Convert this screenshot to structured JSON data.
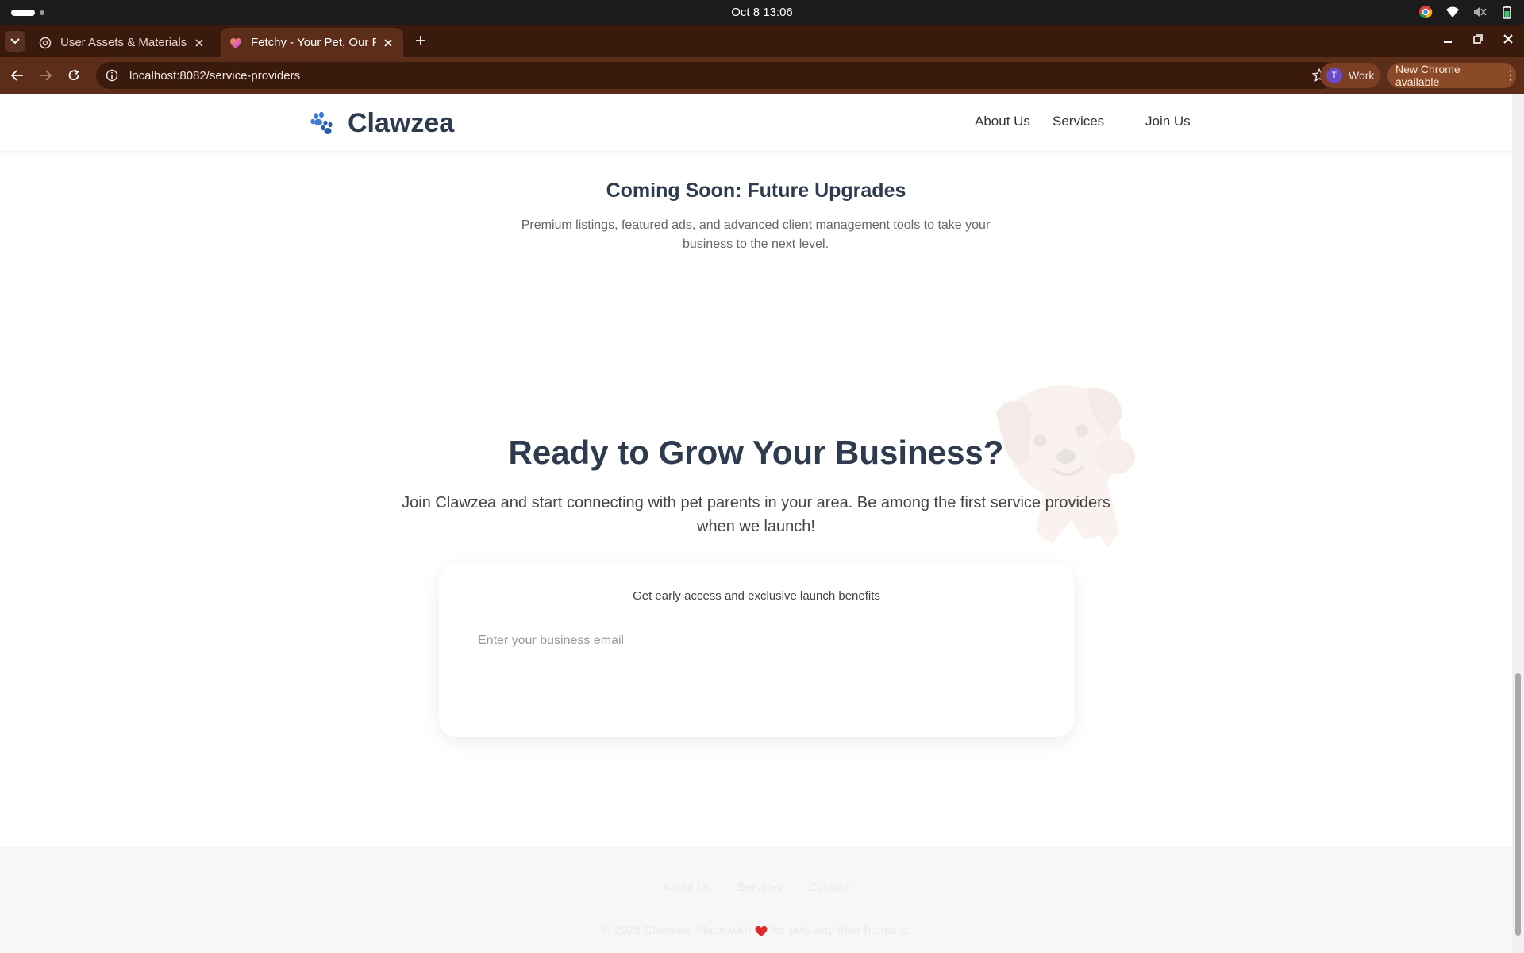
{
  "os": {
    "clock": "Oct 8  13:06"
  },
  "browser": {
    "tabs": [
      {
        "title": "User Assets & Materials",
        "active": false
      },
      {
        "title": "Fetchy - Your Pet, Our Pr",
        "active": true
      }
    ],
    "url": "localhost:8082/service-providers",
    "profile_label": "Work",
    "profile_initial": "T",
    "update_label": "New Chrome available"
  },
  "site": {
    "brand": "Clawzea",
    "nav": [
      "About Us",
      "Services",
      "Join Us"
    ],
    "upgrades": {
      "title": "Coming Soon: Future Upgrades",
      "text": "Premium listings, featured ads, and advanced client management tools to take your business to the next level."
    },
    "cta": {
      "title": "Ready to Grow Your Business?",
      "text": "Join Clawzea and start connecting with pet parents in your area. Be among the first service providers when we launch!"
    },
    "signup": {
      "note": "Get early access and exclusive launch benefits",
      "email_placeholder": "Enter your business email"
    },
    "footer": {
      "links": [
        "About Us",
        "Services",
        "Contact"
      ],
      "copy_before": "© 2025 Clawzea. Made with",
      "copy_after": "for pets and their humans."
    }
  },
  "colors": {
    "brand_text": "#2e3a4d",
    "tab_strip": "#3a1a0c",
    "toolbar": "#5c2e1a"
  }
}
